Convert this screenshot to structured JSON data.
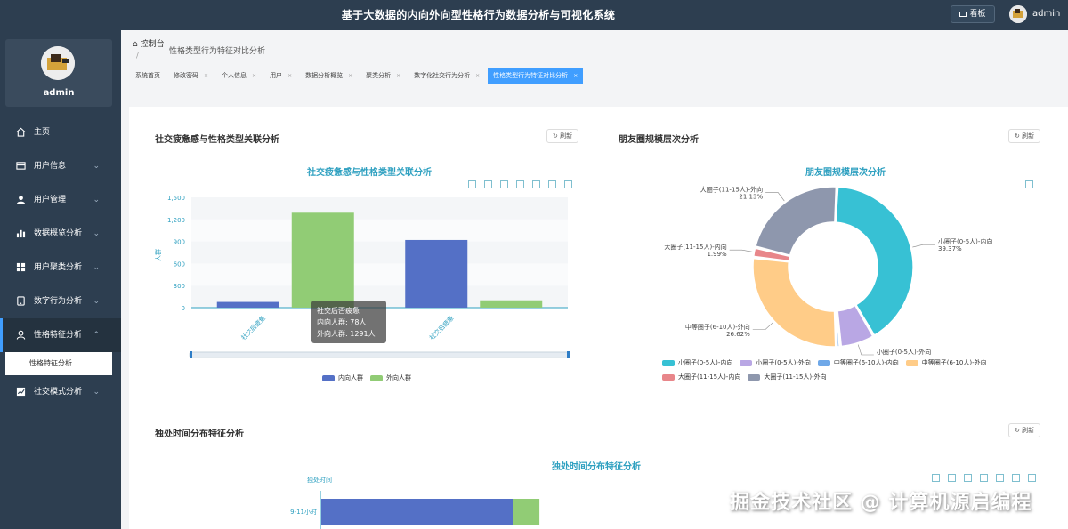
{
  "app": {
    "title": "基于大数据的内向外向型性格行为数据分析与可视化系统",
    "kanban_label": "看板",
    "username": "admin"
  },
  "sidebar": {
    "profile_name": "admin",
    "items": [
      {
        "label": "主页",
        "icon": "home-icon"
      },
      {
        "label": "用户信息",
        "icon": "id-card-icon"
      },
      {
        "label": "用户管理",
        "icon": "user-icon"
      },
      {
        "label": "数据概览分析",
        "icon": "bar-chart-icon"
      },
      {
        "label": "用户聚类分析",
        "icon": "grid-icon"
      },
      {
        "label": "数字行为分析",
        "icon": "tablet-icon"
      },
      {
        "label": "性格特征分析",
        "icon": "person-icon"
      },
      {
        "label": "社交模式分析",
        "icon": "trend-icon"
      }
    ],
    "submenu_label": "性格特征分析"
  },
  "breadcrumb": {
    "root": "控制台",
    "current": "性格类型行为特征对比分析",
    "sep": "/"
  },
  "tabs": [
    {
      "label": "系统首页",
      "closable": false
    },
    {
      "label": "修改密码",
      "closable": true
    },
    {
      "label": "个人信息",
      "closable": true
    },
    {
      "label": "用户",
      "closable": true
    },
    {
      "label": "数据分析概览",
      "closable": true
    },
    {
      "label": "聚类分析",
      "closable": true
    },
    {
      "label": "数字化社交行为分析",
      "closable": true
    },
    {
      "label": "性格类型行为特征对比分析",
      "closable": true,
      "active": true
    }
  ],
  "cards": {
    "fatigue": {
      "title": "社交疲惫感与性格类型关联分析",
      "refresh": "刷新"
    },
    "friends": {
      "title": "朋友圈规模层次分析",
      "refresh": "刷新"
    },
    "alone": {
      "title": "独处时间分布特征分析",
      "refresh": "刷新"
    }
  },
  "chart_data": [
    {
      "type": "bar",
      "title": "社交疲惫感与性格类型关联分析",
      "ylabel": "人群",
      "categories": [
        "社交后疲惫",
        "社交后疲惫"
      ],
      "series": [
        {
          "name": "内向人群",
          "values": [
            78,
            920
          ],
          "color": "#5470c6"
        },
        {
          "name": "外向人群",
          "values": [
            1291,
            100
          ],
          "color": "#91cc75"
        }
      ],
      "ylim": [
        0,
        1500
      ],
      "yticks": [
        "0",
        "300",
        "600",
        "900",
        "1,200",
        "1,500"
      ],
      "tooltip": {
        "title": "社交后否疲惫",
        "lines": [
          "内向人群: 78人",
          "外向人群: 1291人"
        ]
      },
      "legend_position": "bottom"
    },
    {
      "type": "pie",
      "title": "朋友圈规模层次分析",
      "slices": [
        {
          "name": "小圈子(0-5人)-内向",
          "value": 39.37,
          "color": "#37c1d4"
        },
        {
          "name": "小圈子(0-5人)-外向",
          "value": 6.77,
          "color": "#b9a7e4"
        },
        {
          "name": "中等圈子(6-10人)-内向",
          "value": 0.74,
          "color": "#6fa8e8"
        },
        {
          "name": "中等圈子(6-10人)-外向",
          "value": 26.62,
          "color": "#ffcc88"
        },
        {
          "name": "大圈子(11-15人)-内向",
          "value": 1.99,
          "color": "#e8868a"
        },
        {
          "name": "大圈子(11-15人)-外向",
          "value": 21.13,
          "color": "#8e97ad"
        }
      ],
      "visible_labels": [
        {
          "text": "小圈子(0-5人)-内向",
          "pct": "39.37%"
        },
        {
          "text": "大圈子(11-15人)-外向",
          "pct": "21.13%"
        },
        {
          "text": "大圈子(11-15人)-内向",
          "pct": "1.99%"
        },
        {
          "text": "中等圈子(6-10人)-外向",
          "pct": "26.62%"
        },
        {
          "text": "小圈子(0-5人)-外向",
          "pct": ""
        }
      ],
      "legend_position": "bottom"
    },
    {
      "type": "bar",
      "orientation": "horizontal",
      "title": "独处时间分布特征分析",
      "ylabel": "独处时间",
      "categories": [
        "9-11小时"
      ],
      "series": [
        {
          "name": "内向人群",
          "values": [
            1
          ],
          "color": "#5470c6"
        },
        {
          "name": "外向人群",
          "values": [
            0.14
          ],
          "color": "#91cc75"
        }
      ]
    }
  ],
  "watermark": "掘金技术社区 @ 计算机源启编程"
}
